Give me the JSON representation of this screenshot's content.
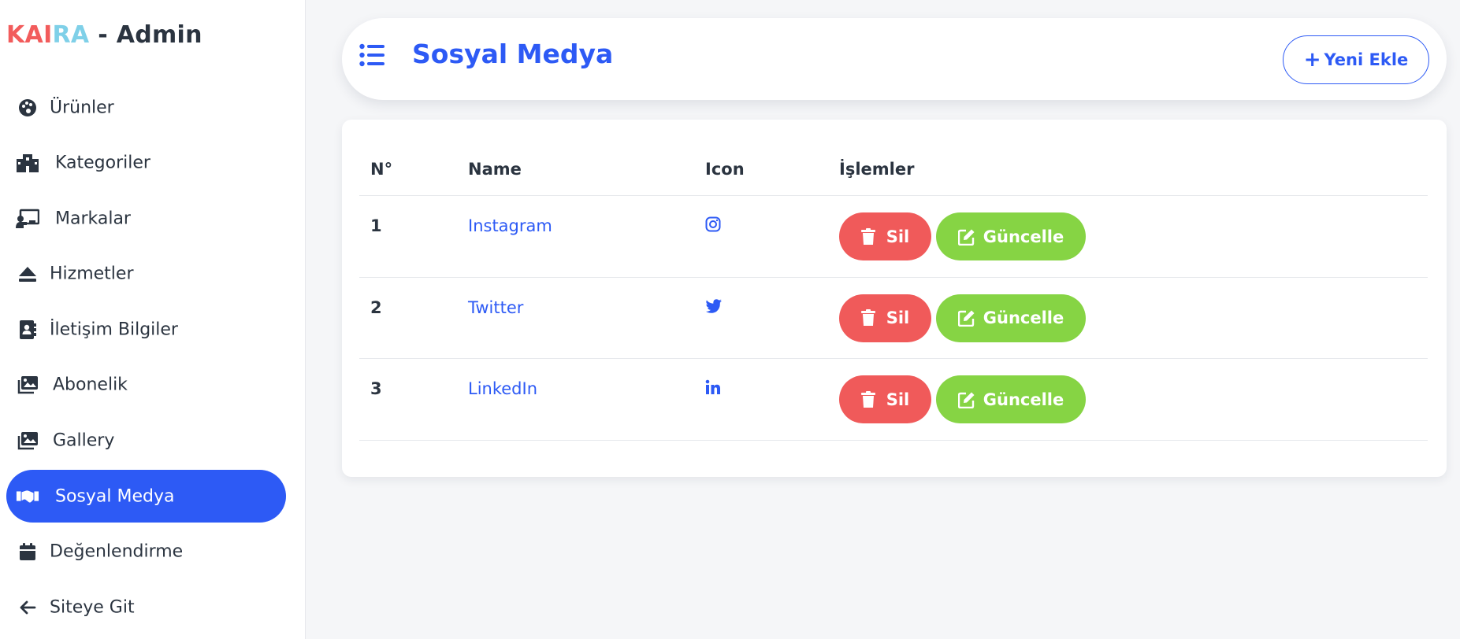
{
  "brand": {
    "part1": "KAI",
    "part2": "RA",
    "part3": " - Admin"
  },
  "sidebar": {
    "items": [
      {
        "label": "Ürünler",
        "icon": "palette-icon",
        "active": false
      },
      {
        "label": "Kategoriler",
        "icon": "building-icon",
        "active": false
      },
      {
        "label": "Markalar",
        "icon": "presentation-icon",
        "active": false
      },
      {
        "label": "Hizmetler",
        "icon": "eject-icon",
        "active": false
      },
      {
        "label": "İletişim Bilgiler",
        "icon": "address-book-icon",
        "active": false
      },
      {
        "label": "Abonelik",
        "icon": "images-icon",
        "active": false
      },
      {
        "label": "Gallery",
        "icon": "images-icon",
        "active": false
      },
      {
        "label": "Sosyal Medya",
        "icon": "handshake-icon",
        "active": true
      },
      {
        "label": "Değenlendirme",
        "icon": "calendar-icon",
        "active": false
      },
      {
        "label": "Siteye Git",
        "icon": "arrow-left-icon",
        "active": false
      }
    ]
  },
  "header": {
    "title": "Sosyal Medya",
    "new_button": "Yeni Ekle",
    "new_button_plus": "+"
  },
  "table": {
    "columns": [
      "N°",
      "Name",
      "Icon",
      "İşlemler"
    ],
    "rows": [
      {
        "no": "1",
        "name": "Instagram",
        "icon": "instagram-icon"
      },
      {
        "no": "2",
        "name": "Twitter",
        "icon": "twitter-icon"
      },
      {
        "no": "3",
        "name": "LinkedIn",
        "icon": "linkedin-icon"
      }
    ],
    "delete_label": "Sil",
    "update_label": "Güncelle"
  },
  "colors": {
    "accent": "#2d5af5",
    "delete": "#f05a5a",
    "update": "#86d444",
    "brand_red": "#f25c5c",
    "brand_cyan": "#7fd0e8"
  }
}
